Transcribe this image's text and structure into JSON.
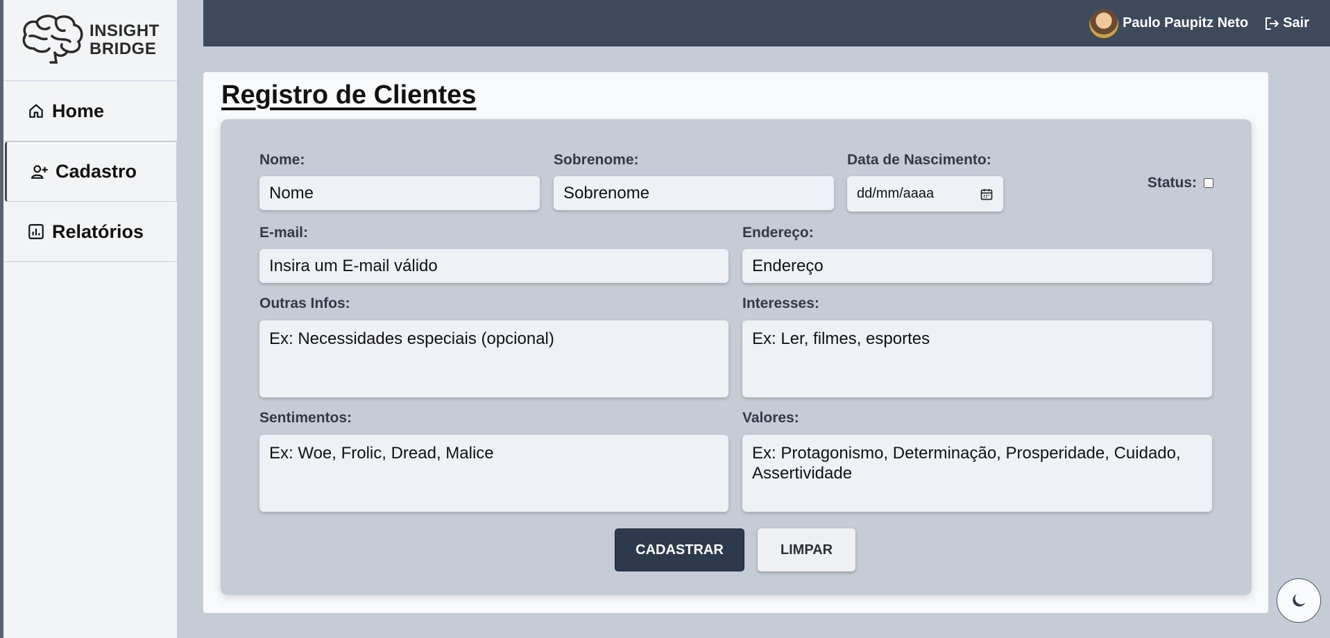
{
  "brand": {
    "line1": "INSIGHT",
    "line2": "BRIDGE"
  },
  "sidebar": {
    "items": [
      {
        "label": "Home",
        "icon": "home-icon"
      },
      {
        "label": "Cadastro",
        "icon": "user-plus-icon",
        "active": true
      },
      {
        "label": "Relatórios",
        "icon": "chart-icon"
      }
    ]
  },
  "topbar": {
    "user_name": "Paulo Paupitz Neto",
    "logout_label": "Sair"
  },
  "page": {
    "title": "Registro de Clientes"
  },
  "form": {
    "nome": {
      "label": "Nome:",
      "placeholder": "Nome"
    },
    "sobrenome": {
      "label": "Sobrenome:",
      "placeholder": "Sobrenome"
    },
    "nascimento": {
      "label": "Data de Nascimento:",
      "placeholder": "dd/mm/aaaa"
    },
    "status": {
      "label": "Status:",
      "checked": false
    },
    "email": {
      "label": "E-mail:",
      "placeholder": "Insira um E-mail válido"
    },
    "endereco": {
      "label": "Endereço:",
      "placeholder": "Endereço"
    },
    "outras": {
      "label": "Outras Infos:",
      "placeholder": "Ex: Necessidades especiais (opcional)"
    },
    "interesses": {
      "label": "Interesses:",
      "placeholder": "Ex: Ler, filmes, esportes"
    },
    "sentimentos": {
      "label": "Sentimentos:",
      "placeholder": "Ex: Woe, Frolic, Dread, Malice"
    },
    "valores": {
      "label": "Valores:",
      "placeholder": "Ex: Protagonismo, Determinação, Prosperidade, Cuidado, Assertividade"
    },
    "submit_label": "CADASTRAR",
    "clear_label": "LIMPAR"
  },
  "colors": {
    "topbar": "#3d4a5c",
    "primary_button": "#2d3a4d",
    "panel": "#c6ccd5"
  }
}
